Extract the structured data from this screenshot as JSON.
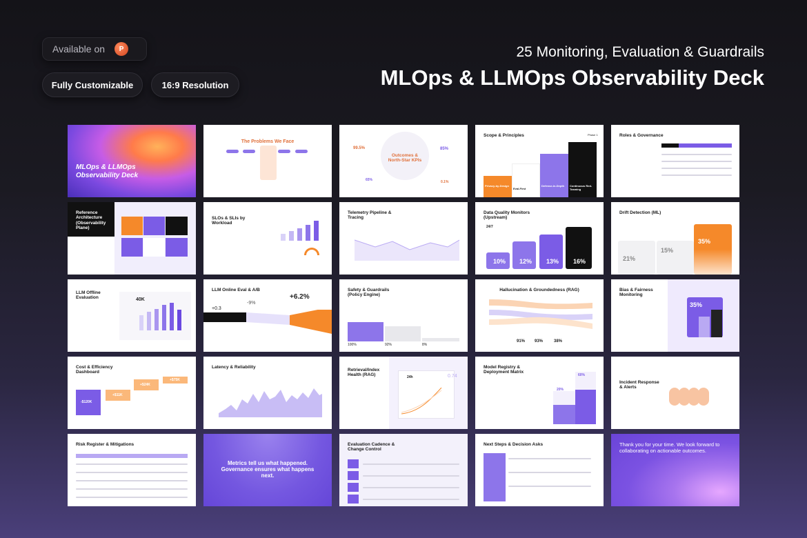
{
  "header": {
    "available_label": "Available on",
    "ppt_icon": "powerpoint-icon",
    "ppt_glyph": "P",
    "badge_customizable": "Fully Customizable",
    "badge_resolution": "16:9 Resolution",
    "subtitle": "25 Monitoring, Evaluation & Guardrails",
    "title": "MLOps & LLMOps Observability Deck"
  },
  "colors": {
    "purple": "#7b5ce6",
    "orange": "#f5892a",
    "dark": "#111111"
  },
  "slides": [
    {
      "title": "MLOps & LLMOps Observability Deck"
    },
    {
      "title": "The Problems We Face"
    },
    {
      "title": "Outcomes & North-Star KPIs",
      "values": [
        "99.5%",
        "85%",
        "65%",
        "0.1%"
      ]
    },
    {
      "title": "Scope & Principles",
      "phase": "Phase 1",
      "items": [
        "Privacy-by-Design",
        "Eval-First",
        "Defense-in-Depth",
        "Continuous Red-Teaming"
      ]
    },
    {
      "title": "Roles & Governance"
    },
    {
      "title": "Reference Architecture (Observability Plane)"
    },
    {
      "title": "SLOs & SLIs by Workload"
    },
    {
      "title": "Telemetry Pipeline & Tracing"
    },
    {
      "title": "Data Quality Monitors (Upstream)",
      "tag": "24/7",
      "values": [
        "10%",
        "12%",
        "13%",
        "16%"
      ]
    },
    {
      "title": "Drift Detection (ML)",
      "values": [
        "21%",
        "15%",
        "35%"
      ]
    },
    {
      "title": "LLM Offline Evaluation",
      "value": "40K"
    },
    {
      "title": "LLM Online Eval & A/B",
      "values": [
        "+0.3",
        "-9%",
        "+6.2%"
      ]
    },
    {
      "title": "Safety & Guardrails (Policy Engine)",
      "values": [
        "100%",
        "92%",
        "8%"
      ]
    },
    {
      "title": "Hallucination & Groundedness (RAG)",
      "values": [
        "91%",
        "93%",
        "38%"
      ]
    },
    {
      "title": "Bias & Fairness Monitoring",
      "value": "35%"
    },
    {
      "title": "Cost & Efficiency Dashboard",
      "values": [
        "-$120K",
        "+$11K",
        "+$24K",
        "+$75K"
      ]
    },
    {
      "title": "Latency & Reliability"
    },
    {
      "title": "Retrieval/Index Health (RAG)",
      "values": [
        "24h",
        "0.74"
      ]
    },
    {
      "title": "Model Registry & Deployment Matrix",
      "values": [
        "20%",
        "60%"
      ]
    },
    {
      "title": "Incident Response & Alerts"
    },
    {
      "title": "Risk Register & Mitigations"
    },
    {
      "title": "Metrics tell us what happened. Governance ensures what happens next."
    },
    {
      "title": "Evaluation Cadence & Change Control"
    },
    {
      "title": "Next Steps & Decision Asks"
    },
    {
      "title": "Thank you for your time. We look forward to collaborating on actionable outcomes."
    }
  ]
}
